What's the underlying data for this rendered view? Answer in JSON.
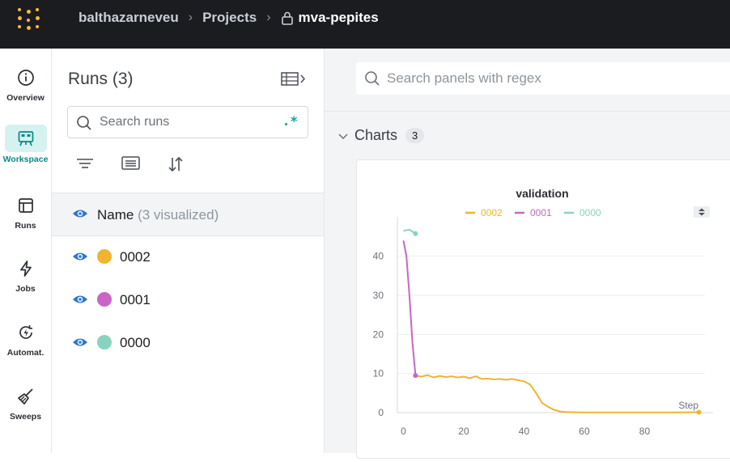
{
  "breadcrumb": {
    "user": "balthazarneveu",
    "projects": "Projects",
    "project": "mva-pepites"
  },
  "nav": [
    {
      "label": "Overview",
      "icon": "info-icon"
    },
    {
      "label": "Workspace",
      "icon": "workspace-icon",
      "active": true
    },
    {
      "label": "Runs",
      "icon": "table-icon"
    },
    {
      "label": "Jobs",
      "icon": "lightning-icon"
    },
    {
      "label": "Automat.",
      "icon": "automation-icon"
    },
    {
      "label": "Sweeps",
      "icon": "broom-icon"
    }
  ],
  "runs_panel": {
    "title": "Runs (3)",
    "search_placeholder": "Search runs",
    "regex_label": ".*",
    "name_header": "Name",
    "visualized": "(3 visualized)",
    "runs": [
      {
        "name": "0002",
        "color": "#f0b431"
      },
      {
        "name": "0001",
        "color": "#c965c8"
      },
      {
        "name": "0000",
        "color": "#87d3c0"
      }
    ]
  },
  "main": {
    "panel_search_placeholder": "Search panels with regex",
    "section_title": "Charts",
    "section_count": "3"
  },
  "chart_data": {
    "type": "line",
    "title": "validation",
    "xlabel": "Step",
    "ylabel": "",
    "xlim": [
      -2,
      100
    ],
    "ylim": [
      0,
      48
    ],
    "xticks": [
      0,
      20,
      40,
      60,
      80
    ],
    "yticks": [
      0,
      10,
      20,
      30,
      40
    ],
    "grid": true,
    "legend_position": "top",
    "series": [
      {
        "name": "0002",
        "color": "#f0b431",
        "x": [
          4,
          6,
          8,
          10,
          12,
          14,
          16,
          18,
          20,
          22,
          24,
          26,
          28,
          30,
          32,
          34,
          36,
          38,
          40,
          42,
          44,
          46,
          48,
          50,
          52,
          54,
          56,
          60,
          70,
          80,
          90,
          98
        ],
        "y": [
          9.5,
          9.2,
          9.6,
          9.0,
          9.4,
          9.1,
          9.3,
          9.0,
          9.2,
          8.8,
          9.3,
          8.6,
          8.7,
          8.5,
          8.6,
          8.4,
          8.6,
          8.3,
          8.0,
          7.2,
          5.0,
          2.5,
          1.5,
          0.7,
          0.3,
          0.15,
          0.1,
          0.05,
          0.05,
          0.05,
          0.05,
          0.1
        ]
      },
      {
        "name": "0001",
        "color": "#c965c8",
        "x": [
          0,
          1,
          2,
          3,
          4
        ],
        "y": [
          44,
          40,
          30,
          18,
          9.5
        ]
      },
      {
        "name": "0000",
        "color": "#87d3c0",
        "x": [
          0,
          2,
          4
        ],
        "y": [
          46.5,
          46.8,
          45.8
        ]
      }
    ]
  }
}
